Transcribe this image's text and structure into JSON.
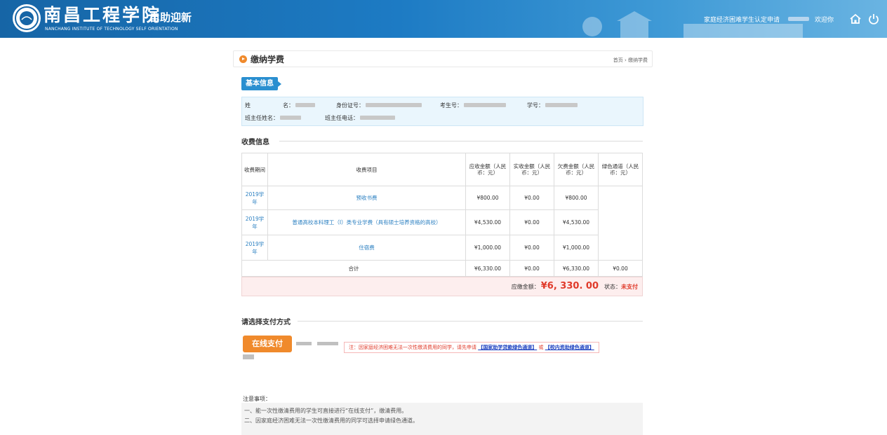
{
  "header": {
    "logo_text": "南昌工程学院",
    "subtitle": "自助迎新",
    "english": "NANCHANG INSTITUTE OF TECHNOLOGY SELF ORIENTATION",
    "link_hardship": "家庭经济困难学生认定申请",
    "welcome": "欢迎你",
    "icons": [
      "home-icon",
      "power-icon"
    ]
  },
  "page": {
    "title": "缴纳学费",
    "breadcrumb": "首页 › 缴纳学费"
  },
  "basic_info": {
    "tag": "基本信息",
    "name_label_1": "姓",
    "name_label_2": "名：",
    "id_label": "身份证号：",
    "exam_label": "考生号：",
    "student_no_label": "学号：",
    "teacher_name_label": "班主任姓名：",
    "teacher_phone_label": "班主任电话："
  },
  "fees": {
    "section_title": "收费信息",
    "headers": [
      "收费期间",
      "收费项目",
      "应收金额（人民币：元）",
      "实收金额（人民币：元）",
      "欠费金额（人民币：元）",
      "绿色通道（人民币：元）"
    ],
    "rows": [
      {
        "period": "2019学年",
        "item": "预收书费",
        "receivable": "¥800.00",
        "received": "¥0.00",
        "owed": "¥800.00"
      },
      {
        "period": "2019学年",
        "item": "普通高校本科理工（Ⅰ）类专业学费（具有硕士培养资格的高校）",
        "receivable": "¥4,530.00",
        "received": "¥0.00",
        "owed": "¥4,530.00"
      },
      {
        "period": "2019学年",
        "item": "住宿费",
        "receivable": "¥1,000.00",
        "received": "¥0.00",
        "owed": "¥1,000.00"
      }
    ],
    "total": {
      "label": "合计",
      "receivable": "¥6,330.00",
      "received": "¥0.00",
      "owed": "¥6,330.00",
      "green": "¥0.00"
    },
    "due_label": "应缴金额：",
    "due_amount": "¥6, 330. 00",
    "status_label": "状态：",
    "status_value": "未支付"
  },
  "payment": {
    "section_title": "请选择支付方式",
    "button_label": "在线支付",
    "notice_text": "注：因家庭经济困难无法一次性缴清费用的同学，请先申请",
    "notice_link1": "【国家助学贷款绿色通道】",
    "notice_or": "或",
    "notice_link2": "【校内资助绿色通道】"
  },
  "notes": {
    "heading": "注意事项：",
    "items": [
      "一、能一次性缴清费用的学生可直接进行“在线支付”，缴清费用。",
      "二、因家庭经济困难无法一次性缴清费用的同学可选择申请绿色通道。"
    ]
  },
  "colors": {
    "header_blue": "#1d7bc4",
    "accent_orange": "#f08a2c",
    "tag_blue": "#2a8fd0",
    "alert_red": "#e03a2a"
  }
}
